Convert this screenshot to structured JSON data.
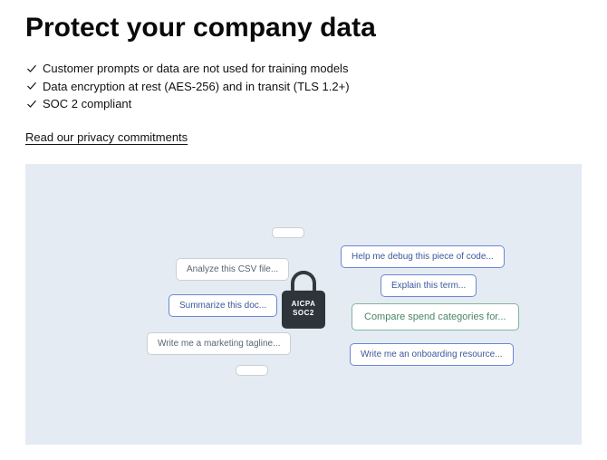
{
  "heading": "Protect your company data",
  "bullets": [
    "Customer prompts or data are not used for training models",
    "Data encryption at rest (AES-256) and in transit (TLS 1.2+)",
    "SOC 2 compliant"
  ],
  "link": "Read our privacy commitments",
  "lock": {
    "line1": "AICPA",
    "line2": "SOC2"
  },
  "chips": {
    "analyze_csv": "Analyze this CSV file...",
    "summarize_doc": "Summarize this doc...",
    "marketing_tagline": "Write me a marketing tagline...",
    "debug_code": "Help me debug this piece of code...",
    "explain_term": "Explain this term...",
    "compare_spend": "Compare spend categories for...",
    "onboarding": "Write me an onboarding resource..."
  }
}
